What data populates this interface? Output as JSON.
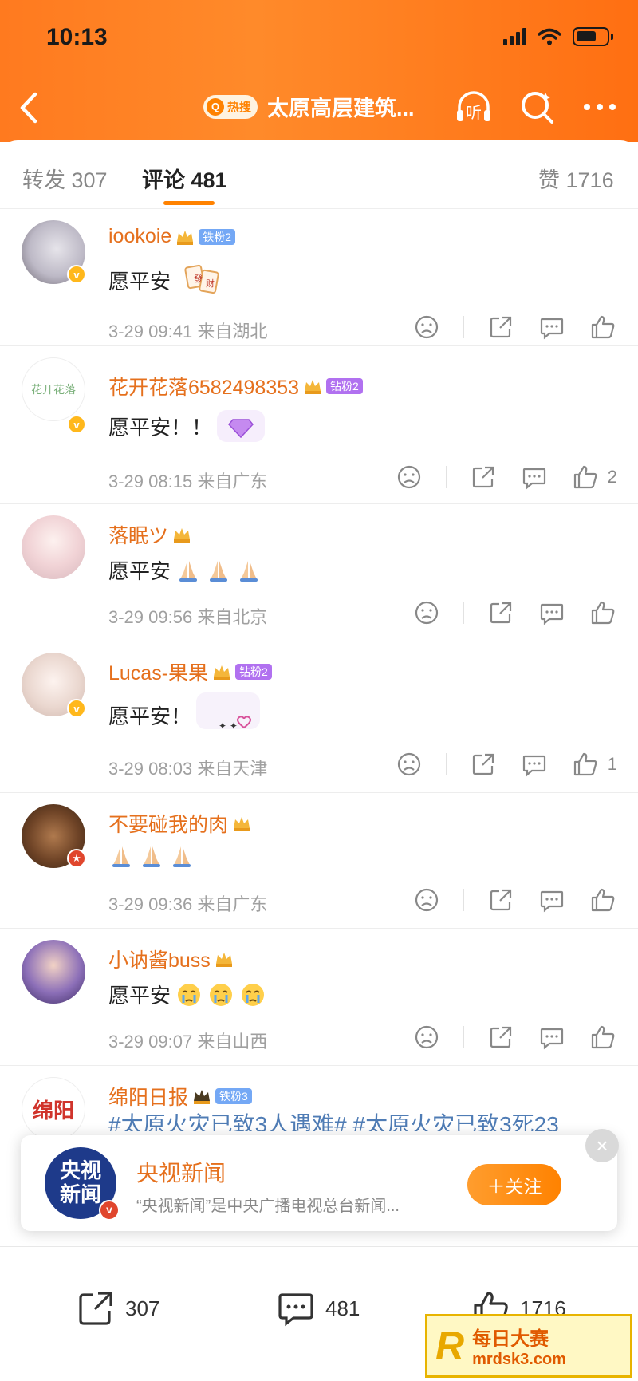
{
  "status_bar": {
    "time": "10:13"
  },
  "header": {
    "hot_badge": "热搜",
    "topic_title": "太原高层建筑...",
    "listen_label": "听"
  },
  "tabs": [
    {
      "label": "转发",
      "count": "307"
    },
    {
      "label": "评论",
      "count": "481"
    },
    {
      "label": "赞",
      "count": "1716"
    }
  ],
  "comments": [
    {
      "username": "iookoie",
      "fan_badge": "铁粉2",
      "text": "愿平安",
      "time": "3-29 09:41",
      "location": "来自湖北",
      "likes": ""
    },
    {
      "username": "花开花落6582498353",
      "fan_badge": "钻粉2",
      "text": "愿平安！！",
      "time": "3-29 08:15",
      "location": "来自广东",
      "likes": "2"
    },
    {
      "username": "落眠ツ",
      "fan_badge": "",
      "text": "愿平安",
      "time": "3-29 09:56",
      "location": "来自北京",
      "likes": ""
    },
    {
      "username": "Lucas-果果",
      "fan_badge": "钻粉2",
      "text": "愿平安！",
      "time": "3-29 08:03",
      "location": "来自天津",
      "likes": "1"
    },
    {
      "username": "不要碰我的肉",
      "fan_badge": "",
      "text": "",
      "time": "3-29 09:36",
      "location": "来自广东",
      "likes": ""
    },
    {
      "username": "小讷酱buss",
      "fan_badge": "",
      "text": "愿平安",
      "time": "3-29 09:07",
      "location": "来自山西",
      "likes": ""
    },
    {
      "username": "绵阳日报",
      "fan_badge": "铁粉3",
      "text": "#太原火灾已致3人遇难# #太原火灾已致3死23",
      "time": "",
      "location": "",
      "likes": ""
    }
  ],
  "avatar_texts": {
    "c2": "花开花落",
    "c7": "绵阳"
  },
  "follow_toast": {
    "logo_text_1": "央视",
    "logo_text_2": "新闻",
    "name": "央视新闻",
    "description": "“央视新闻”是中央广播电视总台新闻...",
    "follow_label": "＋关注",
    "close_label": "×"
  },
  "bottom_bar": {
    "repost_count": "307",
    "comment_count": "481",
    "like_count": "1716"
  },
  "watermark": {
    "title": "每日大赛",
    "url": "mrdsk3.com"
  },
  "colors": {
    "brand_orange": "#ff8200",
    "username": "#e5701d",
    "iron_fan": "#74a8f5",
    "diamond_fan": "#b171f0"
  }
}
